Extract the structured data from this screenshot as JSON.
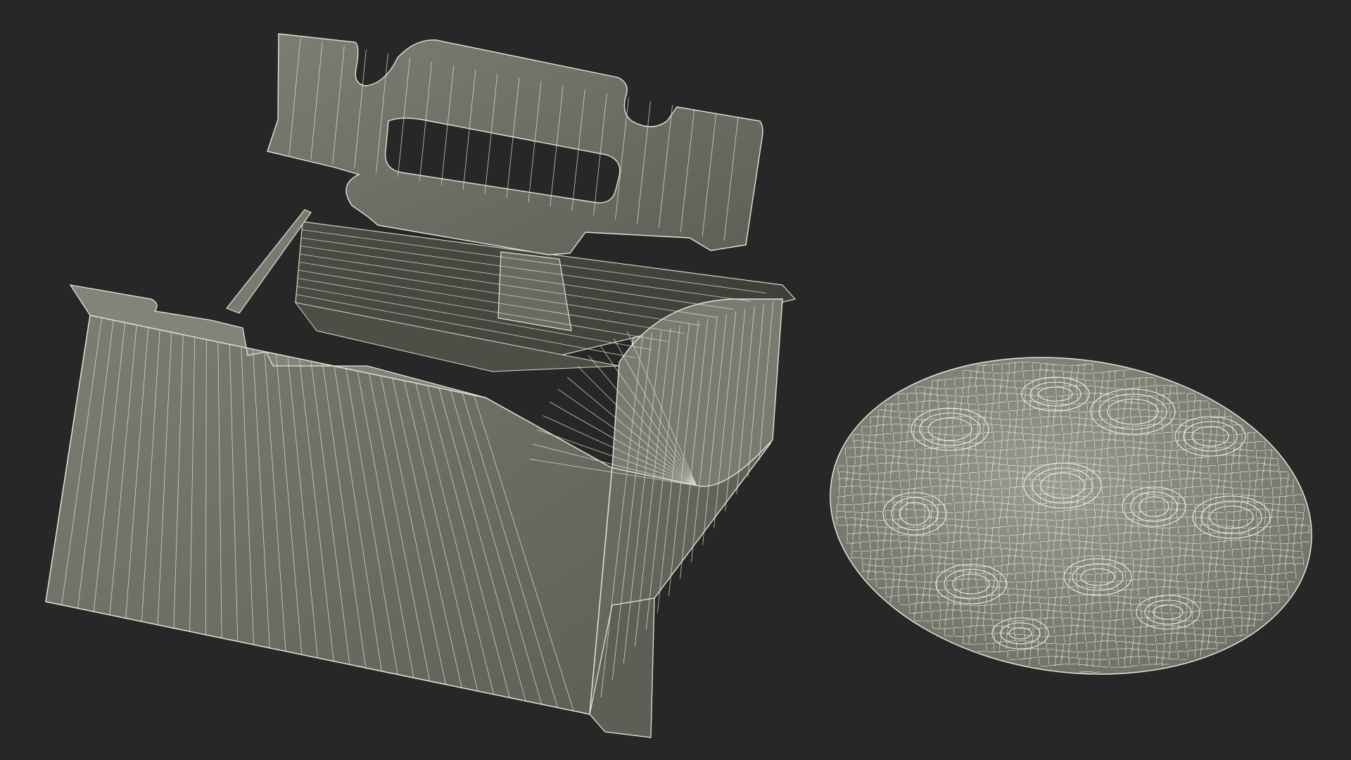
{
  "scene": {
    "render_style": "wireframe",
    "colors": {
      "background": "#272727",
      "surface_box": "#6e6e66",
      "surface_box_light": "#7c7c73",
      "surface_box_dark": "#53534b",
      "surface_cookie": "#8a8a80",
      "wire": "#e4e4d6"
    },
    "objects": [
      {
        "name": "takeout-box",
        "kind": "open folding paper box with handle"
      },
      {
        "name": "cookie",
        "kind": "flat round cookie"
      }
    ]
  }
}
